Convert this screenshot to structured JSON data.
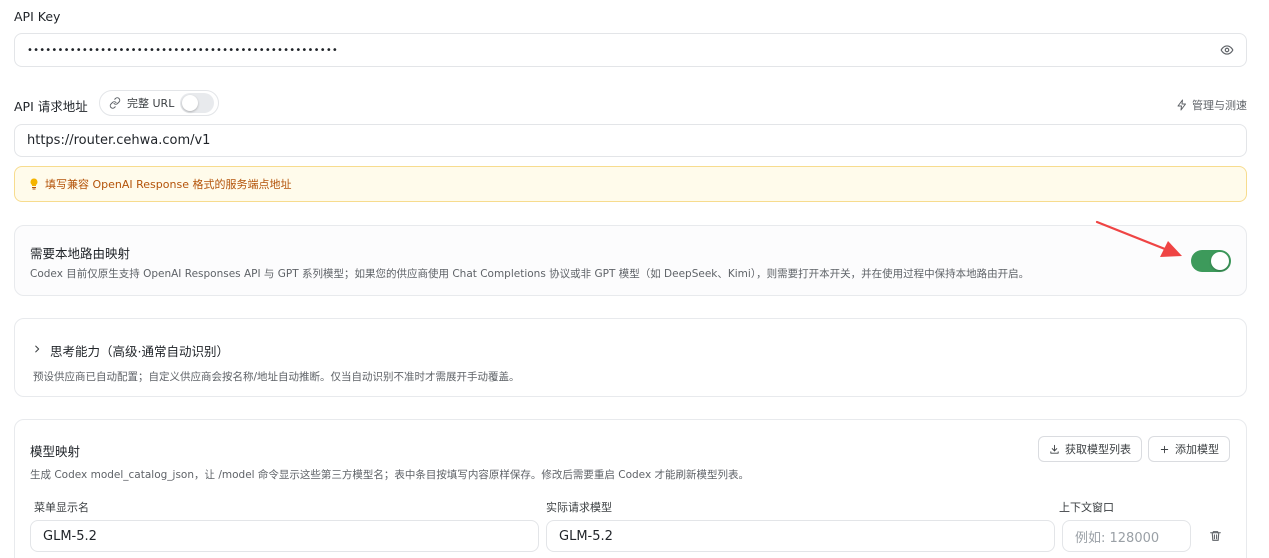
{
  "api_key": {
    "label": "API Key",
    "value": "•••••••••••••••••••••••••••••••••••••••••••••••••••"
  },
  "api_url": {
    "label": "API 请求地址",
    "full_url_toggle_label": "完整 URL",
    "full_url_enabled": false,
    "manage_label": "管理与测速",
    "value": "https://router.cehwa.com/v1"
  },
  "notice": {
    "text": "填写兼容 OpenAI Response 格式的服务端点地址",
    "color": "#b45309"
  },
  "local_routing": {
    "title": "需要本地路由映射",
    "description": "Codex 目前仅原生支持 OpenAI Responses API 与 GPT 系列模型；如果您的供应商使用 Chat Completions 协议或非 GPT 模型（如 DeepSeek、Kimi），则需要打开本开关，并在使用过程中保持本地路由开启。",
    "enabled": true,
    "accent": "#3d9a5b"
  },
  "thinking": {
    "title": "思考能力（高级·通常自动识别）",
    "description": "预设供应商已自动配置；自定义供应商会按名称/地址自动推断。仅当自动识别不准时才需展开手动覆盖。"
  },
  "model_mapping": {
    "title": "模型映射",
    "description": "生成 Codex model_catalog_json，让 /model 命令显示这些第三方模型名；表中条目按填写内容原样保存。修改后需要重启 Codex 才能刷新模型列表。",
    "fetch_button": "获取模型列表",
    "add_button": "添加模型",
    "columns": {
      "display_name": "菜单显示名",
      "request_model": "实际请求模型",
      "context_window": "上下文窗口"
    },
    "rows": [
      {
        "display_name": "GLM-5.2",
        "request_model": "GLM-5.2",
        "context_window_placeholder": "例如: 128000"
      }
    ]
  }
}
